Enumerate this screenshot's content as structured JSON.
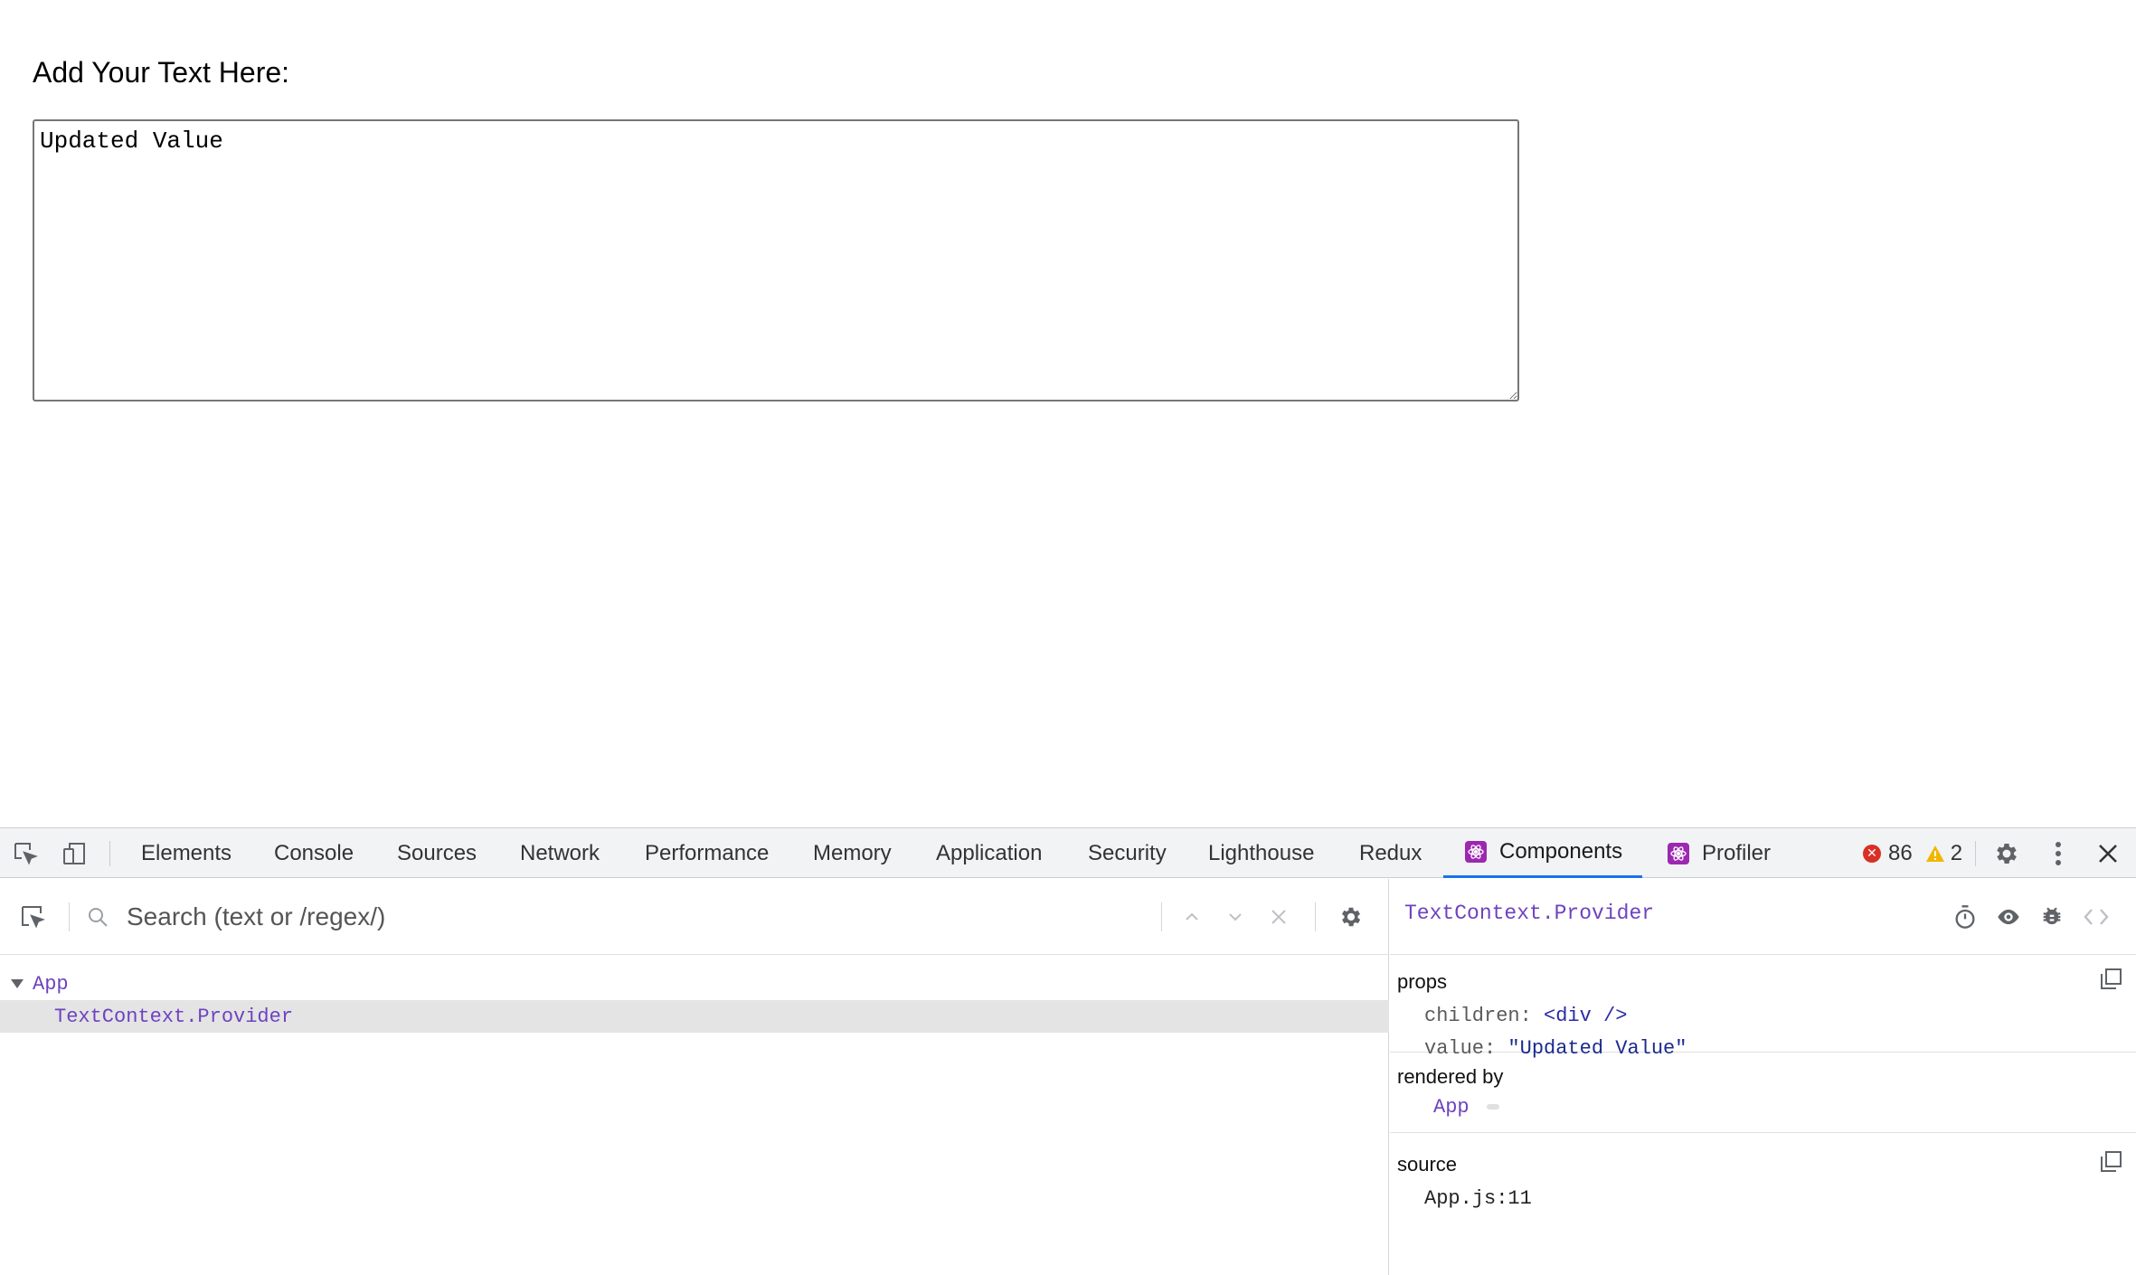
{
  "page": {
    "label": "Add Your Text Here:",
    "textarea_value": "Updated Value"
  },
  "devtools": {
    "tabs": [
      {
        "label": "Elements"
      },
      {
        "label": "Console"
      },
      {
        "label": "Sources"
      },
      {
        "label": "Network"
      },
      {
        "label": "Performance"
      },
      {
        "label": "Memory"
      },
      {
        "label": "Application"
      },
      {
        "label": "Security"
      },
      {
        "label": "Lighthouse"
      },
      {
        "label": "Redux"
      },
      {
        "label": "Components",
        "active": true
      },
      {
        "label": "Profiler"
      }
    ],
    "error_count": "86",
    "warning_count": "2",
    "accent_color": "#1a73e8",
    "react_color": "#9c27b0"
  },
  "tree": {
    "search_placeholder": "Search (text or /regex/)",
    "rows": [
      {
        "label": "App",
        "expanded": true
      },
      {
        "label": "TextContext.Provider",
        "selected": true
      }
    ]
  },
  "inspector": {
    "title": "TextContext.Provider",
    "props_title": "props",
    "props": [
      {
        "key": "children",
        "value": "<div />"
      },
      {
        "key": "value",
        "value": "\"Updated Value\""
      }
    ],
    "rendered_by_title": "rendered by",
    "rendered_by": "App",
    "source_title": "source",
    "source": "App.js:11"
  }
}
